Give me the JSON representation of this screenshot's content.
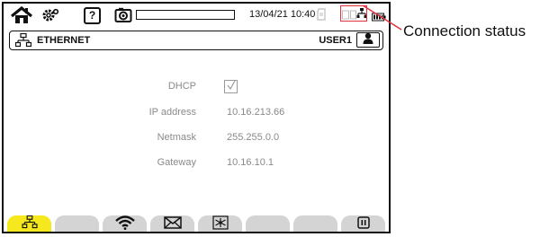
{
  "status_bar": {
    "icons": [
      "home-icon",
      "settings-gear-icon",
      "help-icon",
      "screenshot-camera-icon",
      "sd-card-icon",
      "connection-status-icon",
      "battery-icon"
    ],
    "help_label": "?",
    "memory_progress": 0.0,
    "datetime": "13/04/21 10:40"
  },
  "header": {
    "icon": "ethernet-icon",
    "title": "ETHERNET",
    "user": "USER1",
    "user_icon": "user-profile-icon"
  },
  "form": {
    "dhcp": {
      "label": "DHCP",
      "checked": true
    },
    "ip": {
      "label": "IP address",
      "value": "10.16.213.66"
    },
    "netmask": {
      "label": "Netmask",
      "value": "255.255.0.0"
    },
    "gateway": {
      "label": "Gateway",
      "value": "10.16.10.1"
    }
  },
  "softkeys": [
    {
      "icon": "ethernet-icon",
      "active": true
    },
    {
      "icon": "",
      "active": false
    },
    {
      "icon": "wifi-icon",
      "active": false
    },
    {
      "icon": "email-icon",
      "active": false
    },
    {
      "icon": "network-star-icon",
      "active": false
    },
    {
      "icon": "",
      "active": false
    },
    {
      "icon": "",
      "active": false
    },
    {
      "icon": "pause-icon",
      "active": false
    }
  ],
  "colors": {
    "active_softkey": "#f5e81c",
    "softkey": "#d4d4d4",
    "callout": "#e0313d",
    "disabled_text": "#8a8a8a"
  },
  "callout": {
    "label": "Connection status"
  }
}
